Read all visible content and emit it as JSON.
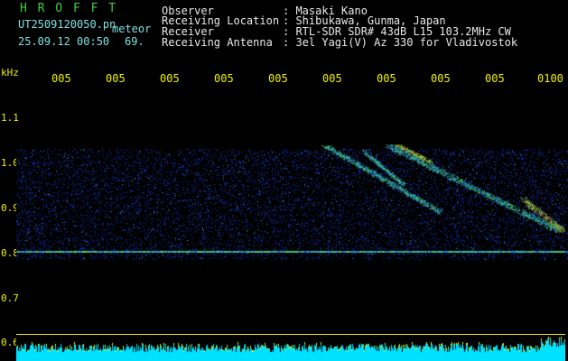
{
  "header": {
    "brand": "H R O F F T",
    "filename": "UT2509120050.pn",
    "mode": "meteor",
    "datetime": "25.09.12 00:50",
    "count": "69."
  },
  "info": {
    "observer_label": "Observer",
    "observer_value": ": Masaki Kano",
    "location_label": "Receiving Location",
    "location_value": ": Shibukawa, Gunma, Japan",
    "receiver_label": "Receiver",
    "receiver_value": ": RTL-SDR SDR# 43dB L15 103.2MHz CW",
    "antenna_label": "Receiving Antenna",
    "antenna_value": ": 3el Yagi(V) Az 330 for Vladivostok"
  },
  "axis": {
    "unit": "kHz",
    "y_ticks": [
      "1.1",
      "1.0",
      "0.9",
      "0.8",
      "0.7",
      "0.6"
    ],
    "time_ticks": [
      "005",
      "005",
      "005",
      "005",
      "005",
      "005",
      "005",
      "005",
      "005",
      "0100"
    ]
  },
  "colors": {
    "background": "#000000",
    "noise_blue": "#1030c0",
    "signal_cyan": "#30c0c0",
    "signal_yellow": "#e8e000",
    "signal_red": "#e02020",
    "bar_cyan": "#00e0ff",
    "bar_yellow": "#f0f000"
  }
}
